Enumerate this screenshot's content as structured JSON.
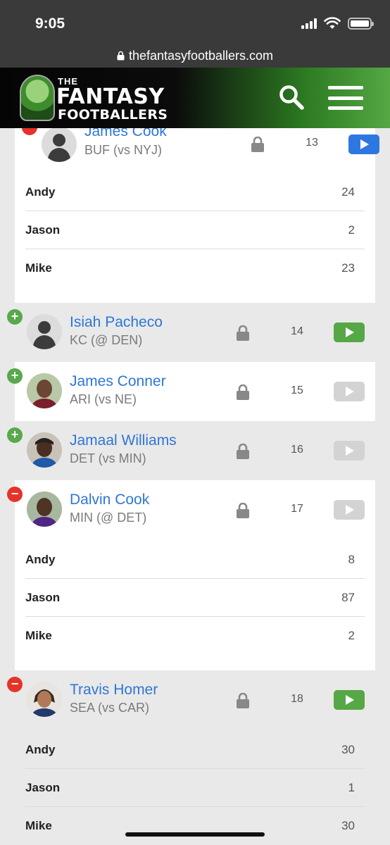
{
  "status": {
    "time": "9:05"
  },
  "browser": {
    "url": "thefantasyfootballers.com"
  },
  "site": {
    "logo_the": "THE",
    "logo_line1": "FANTASY",
    "logo_line2": "FOOTBALLERS"
  },
  "players": [
    {
      "name": "James Cook",
      "team": "BUF (vs NYJ)",
      "rank": "13",
      "badge": "−",
      "play": "blue"
    },
    {
      "name": "Isiah Pacheco",
      "team": "KC (@ DEN)",
      "rank": "14",
      "badge": "+",
      "play": "green"
    },
    {
      "name": "James Conner",
      "team": "ARI (vs NE)",
      "rank": "15",
      "badge": "+",
      "play": "light"
    },
    {
      "name": "Jamaal Williams",
      "team": "DET (vs MIN)",
      "rank": "16",
      "badge": "+",
      "play": "light"
    },
    {
      "name": "Dalvin Cook",
      "team": "MIN (@ DET)",
      "rank": "17",
      "badge": "−",
      "play": "light"
    },
    {
      "name": "Travis Homer",
      "team": "SEA (vs CAR)",
      "rank": "18",
      "badge": "−",
      "play": "green"
    }
  ],
  "rankings": {
    "james_cook": [
      {
        "name": "Andy",
        "value": "24"
      },
      {
        "name": "Jason",
        "value": "2"
      },
      {
        "name": "Mike",
        "value": "23"
      }
    ],
    "dalvin_cook": [
      {
        "name": "Andy",
        "value": "8"
      },
      {
        "name": "Jason",
        "value": "87"
      },
      {
        "name": "Mike",
        "value": "2"
      }
    ],
    "travis_homer": [
      {
        "name": "Andy",
        "value": "30"
      },
      {
        "name": "Jason",
        "value": "1"
      },
      {
        "name": "Mike",
        "value": "30"
      }
    ]
  },
  "colors": {
    "accent_blue": "#2f76d5",
    "play_green": "#56a745",
    "remove_red": "#e5332a"
  }
}
